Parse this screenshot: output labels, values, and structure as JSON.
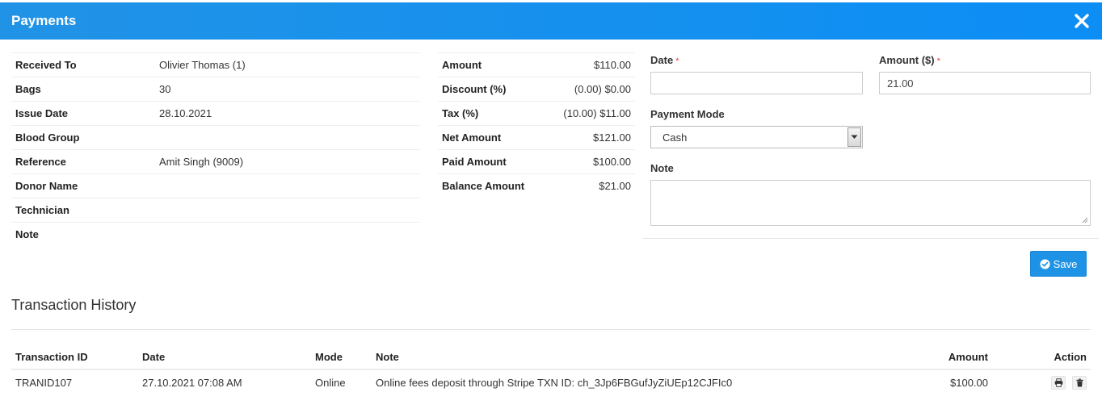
{
  "header": {
    "title": "Payments",
    "close_icon": "close-icon"
  },
  "info": [
    {
      "label": "Received To",
      "value": "Olivier Thomas (1)"
    },
    {
      "label": "Bags",
      "value": "30"
    },
    {
      "label": "Issue Date",
      "value": "28.10.2021"
    },
    {
      "label": "Blood Group",
      "value": ""
    },
    {
      "label": "Reference",
      "value": "Amit Singh (9009)"
    },
    {
      "label": "Donor Name",
      "value": ""
    },
    {
      "label": "Technician",
      "value": ""
    },
    {
      "label": "Note",
      "value": ""
    }
  ],
  "amounts": [
    {
      "label": "Amount",
      "value": "$110.00"
    },
    {
      "label": "Discount (%)",
      "value": "(0.00) $0.00"
    },
    {
      "label": "Tax (%)",
      "value": "(10.00) $11.00"
    },
    {
      "label": "Net Amount",
      "value": "$121.00"
    },
    {
      "label": "Paid Amount",
      "value": "$100.00"
    },
    {
      "label": "Balance Amount",
      "value": "$21.00"
    }
  ],
  "form": {
    "date_label": "Date",
    "date_value": "",
    "amount_label": "Amount ($)",
    "amount_value": "21.00",
    "required_mark": "*",
    "payment_mode_label": "Payment Mode",
    "payment_mode_value": "Cash",
    "note_label": "Note",
    "note_value": "",
    "save_label": "Save"
  },
  "transactions": {
    "title": "Transaction History",
    "columns": [
      "Transaction ID",
      "Date",
      "Mode",
      "Note",
      "Amount",
      "Action"
    ],
    "rows": [
      {
        "id": "TRANID107",
        "date": "27.10.2021 07:08 AM",
        "mode": "Online",
        "note": "Online fees deposit through Stripe TXN ID: ch_3Jp6FBGufJyZiUEp12CJFIc0",
        "amount": "$100.00"
      }
    ]
  },
  "colors": {
    "header": "#1e93e6",
    "accent": "#1e93e6",
    "required": "#e0413a"
  }
}
